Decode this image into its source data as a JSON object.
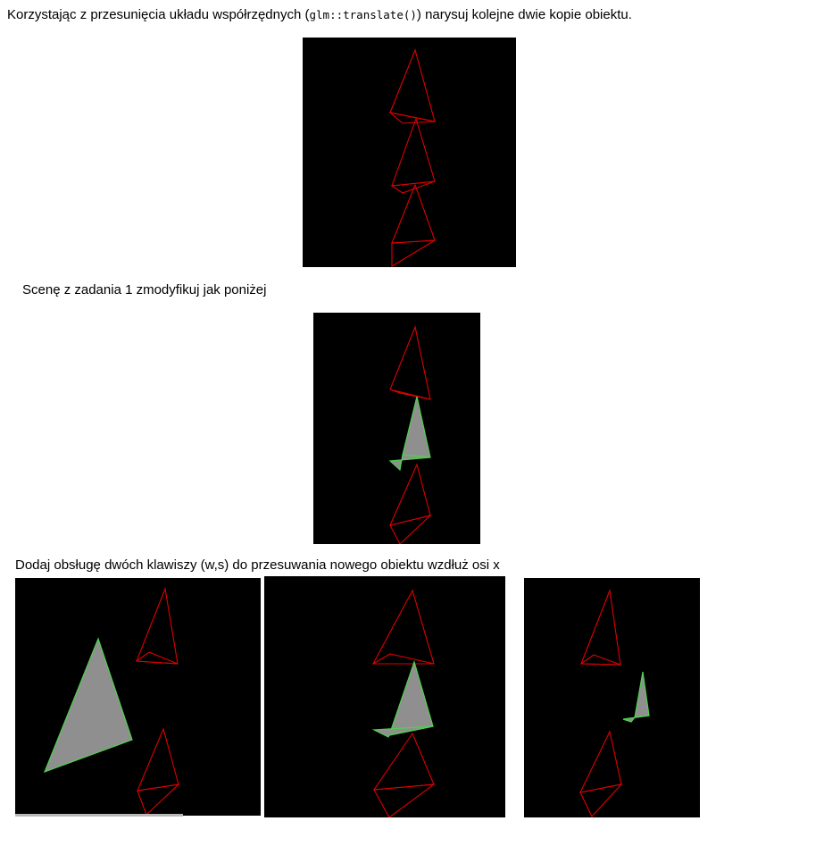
{
  "task1": {
    "text_before": "Korzystając z przesunięcia układu współrzędnych (",
    "code": "glm::translate()",
    "text_after": ") narysuj kolejne dwie kopie obiektu."
  },
  "task2": {
    "text": "Scenę z zadania 1 zmodyfikuj  jak poniżej"
  },
  "task3": {
    "text": "Dodaj obsługę dwóch klawiszy (w,s) do przesuwania nowego obiektu wzdłuż osi x"
  },
  "colors": {
    "background": "#ffffff",
    "render_background": "#000000",
    "wireframe": "#e00000",
    "solid_fill": "#8f8f8f",
    "solid_edge": "#4fd04f"
  },
  "figures": [
    {
      "id": "task1-render",
      "content": "three red wireframe copies of the object stacked vertically"
    },
    {
      "id": "task2-render",
      "content": "red wireframe top and bottom copies, solid grey middle copy with green edges"
    },
    {
      "id": "task3-render-a",
      "content": "new solid object moved far left"
    },
    {
      "id": "task3-render-b",
      "content": "new solid object in the centre"
    },
    {
      "id": "task3-render-c",
      "content": "new solid object moved right, smaller"
    }
  ]
}
